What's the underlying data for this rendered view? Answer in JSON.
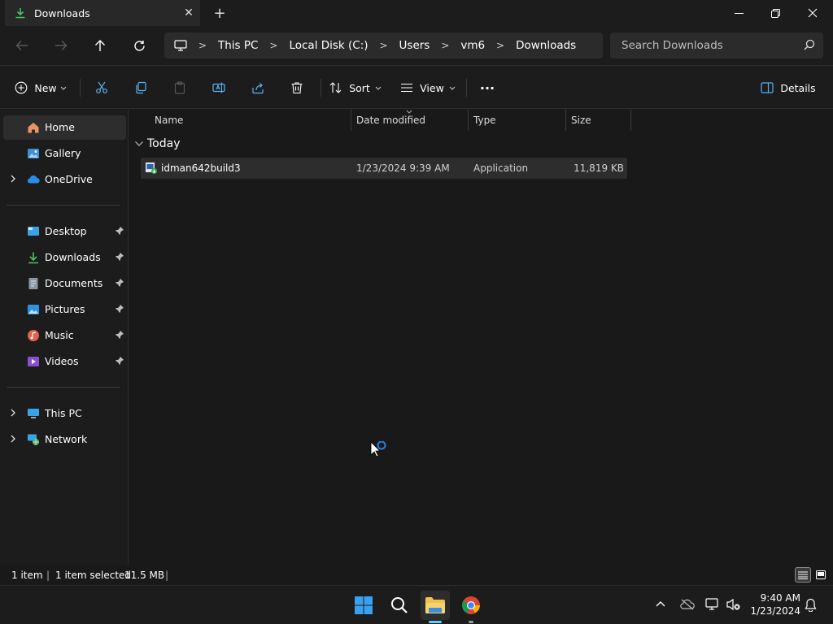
{
  "window": {
    "tab_title": "Downloads",
    "close_tab": "✕",
    "new_tab": "+"
  },
  "address": {
    "crumbs": [
      "This PC",
      "Local Disk (C:)",
      "Users",
      "vm6",
      "Downloads"
    ]
  },
  "search": {
    "placeholder": "Search Downloads"
  },
  "toolbar": {
    "new_label": "New",
    "sort_label": "Sort",
    "view_label": "View",
    "more_label": "···",
    "details_label": "Details"
  },
  "sidebar": {
    "items": [
      {
        "label": "Home"
      },
      {
        "label": "Gallery"
      },
      {
        "label": "OneDrive"
      },
      {
        "label": "Desktop"
      },
      {
        "label": "Downloads"
      },
      {
        "label": "Documents"
      },
      {
        "label": "Pictures"
      },
      {
        "label": "Music"
      },
      {
        "label": "Videos"
      },
      {
        "label": "This PC"
      },
      {
        "label": "Network"
      }
    ]
  },
  "columns": {
    "name": "Name",
    "date": "Date modified",
    "type": "Type",
    "size": "Size"
  },
  "group": {
    "label": "Today"
  },
  "files": [
    {
      "name": "idman642build3",
      "date": "1/23/2024 9:39 AM",
      "type": "Application",
      "size": "11,819 KB"
    }
  ],
  "status": {
    "count": "1 item",
    "selected": "1 item selected",
    "selected_size": "11.5 MB"
  },
  "clock": {
    "time": "9:40 AM",
    "date": "1/23/2024"
  },
  "colors": {
    "accent": "#60cdff",
    "folder": "#f2c14e",
    "background": "#191919"
  }
}
